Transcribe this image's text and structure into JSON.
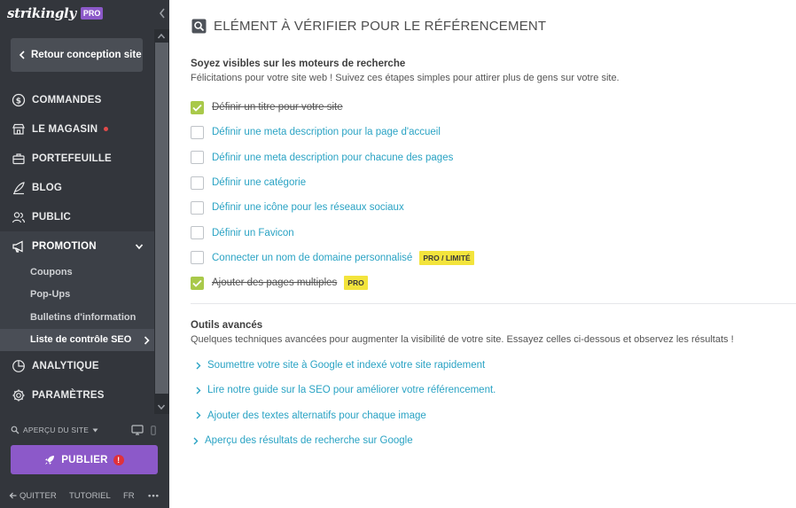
{
  "sidebar": {
    "logo": "strikingly",
    "logo_badge": "PRO",
    "back_label": "Retour conception site",
    "nav": [
      {
        "label": "COMMANDES",
        "icon": "dollar-circle-icon"
      },
      {
        "label": "LE MAGASIN",
        "icon": "store-icon",
        "has_dot": true
      },
      {
        "label": "PORTEFEUILLE",
        "icon": "briefcase-icon"
      },
      {
        "label": "BLOG",
        "icon": "quill-icon"
      },
      {
        "label": "PUBLIC",
        "icon": "people-icon"
      },
      {
        "label": "PROMOTION",
        "icon": "megaphone-icon",
        "active": true
      },
      {
        "label": "ANALYTIQUE",
        "icon": "pie-chart-icon"
      },
      {
        "label": "PARAMÈTRES",
        "icon": "gear-icon"
      }
    ],
    "promotion_sub": [
      {
        "label": "Coupons"
      },
      {
        "label": "Pop-Ups"
      },
      {
        "label": "Bulletins d'information"
      },
      {
        "label": "Liste de contrôle SEO",
        "current": true
      }
    ],
    "preview_label": "APERÇU DU SITE",
    "publish_label": "PUBLIER",
    "publish_alert": "!",
    "footer": {
      "quit": "QUITTER",
      "tutorial": "TUTORIEL",
      "lang": "FR",
      "more": "•••"
    }
  },
  "main": {
    "title": "ELÉMENT À VÉRIFIER POUR LE RÉFÉRENCEMENT",
    "visible_head": "Soyez visibles sur les moteurs de recherche",
    "visible_desc": "Félicitations pour votre site web ! Suivez ces étapes simples pour attirer plus de gens sur votre site.",
    "checklist": [
      {
        "label": "Définir un titre pour votre site",
        "checked": true
      },
      {
        "label": "Définir une meta description pour la page d'accueil",
        "checked": false
      },
      {
        "label": "Définir une meta description pour chacune des pages",
        "checked": false
      },
      {
        "label": "Définir une catégorie",
        "checked": false
      },
      {
        "label": "Définir une icône pour les réseaux sociaux",
        "checked": false
      },
      {
        "label": "Définir un Favicon",
        "checked": false
      },
      {
        "label": "Connecter un nom de domaine personnalisé",
        "checked": false,
        "tag": "PRO / LIMITÉ"
      },
      {
        "label": "Ajouter des pages multiples",
        "checked": true,
        "tag": "PRO"
      }
    ],
    "advanced_head": "Outils avancés",
    "advanced_desc": "Quelques techniques avancées pour augmenter la visibilité de votre site. Essayez celles ci-dessous et observez les résultats !",
    "advanced_links": [
      {
        "label": "Soumettre votre site à Google et indexé votre site rapidement"
      },
      {
        "label": "Lire notre guide sur la SEO pour améliorer votre référencement."
      },
      {
        "label": "Ajouter des textes alternatifs pour chaque image"
      },
      {
        "label": "Aperçu des résultats de recherche sur Google"
      }
    ]
  },
  "colors": {
    "sidebar_bg": "#33363c",
    "accent_purple": "#8c59c9",
    "link_blue": "#2aa3c4",
    "check_green": "#a9c94a",
    "tag_yellow": "#f3e43c"
  }
}
